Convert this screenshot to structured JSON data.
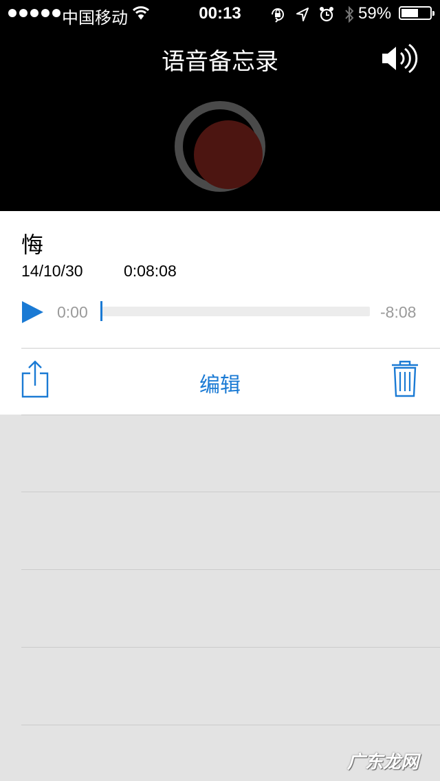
{
  "status_bar": {
    "carrier": "中国移动",
    "time": "00:13",
    "battery_percent": "59%",
    "battery_level": 0.59,
    "icons": [
      "signal-dots-icon",
      "wifi-icon",
      "orientation-lock-icon",
      "location-arrow-icon",
      "alarm-icon",
      "bluetooth-icon",
      "battery-icon"
    ]
  },
  "header": {
    "title": "语音备忘录",
    "speaker_icon": "speaker-icon",
    "record_icon": "record-icon"
  },
  "memo": {
    "name": "悔",
    "date": "14/10/30",
    "duration": "0:08:08",
    "elapsed": "0:00",
    "remaining": "-8:08",
    "progress": 0.0
  },
  "actions": {
    "share_icon": "share-icon",
    "edit_label": "编辑",
    "trash_icon": "trash-icon"
  },
  "watermark": "广东龙网",
  "colors": {
    "accent": "#1a7ad4",
    "record": "#4c1511",
    "background": "#e3e3e3",
    "header_bg": "#000000"
  }
}
